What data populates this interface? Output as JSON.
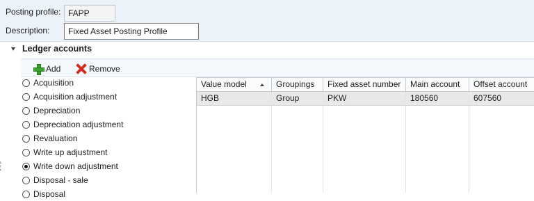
{
  "form": {
    "posting_profile_label": "Posting profile:",
    "posting_profile_value": "FAPP",
    "description_label": "Description:",
    "description_value": "Fixed Asset Posting Profile"
  },
  "section": {
    "title": "Ledger accounts"
  },
  "toolbar": {
    "add_label": "Add",
    "add_icon": "green-plus-icon",
    "remove_label": "Remove",
    "remove_icon": "red-x-icon"
  },
  "transaction_types": [
    {
      "label": "Acquisition",
      "selected": false
    },
    {
      "label": "Acquisition adjustment",
      "selected": false
    },
    {
      "label": "Depreciation",
      "selected": false
    },
    {
      "label": "Depreciation adjustment",
      "selected": false
    },
    {
      "label": "Revaluation",
      "selected": false
    },
    {
      "label": "Write up adjustment",
      "selected": false
    },
    {
      "label": "Write down adjustment",
      "selected": true
    },
    {
      "label": "Disposal - sale",
      "selected": false
    },
    {
      "label": "Disposal",
      "selected": false
    }
  ],
  "grid": {
    "columns": [
      "Value model",
      "Groupings",
      "Fixed asset number",
      "Main account",
      "Offset account"
    ],
    "sort_column": "Value model",
    "rows": [
      [
        "HGB",
        "Group",
        "PKW",
        "180560",
        "607560"
      ]
    ]
  }
}
